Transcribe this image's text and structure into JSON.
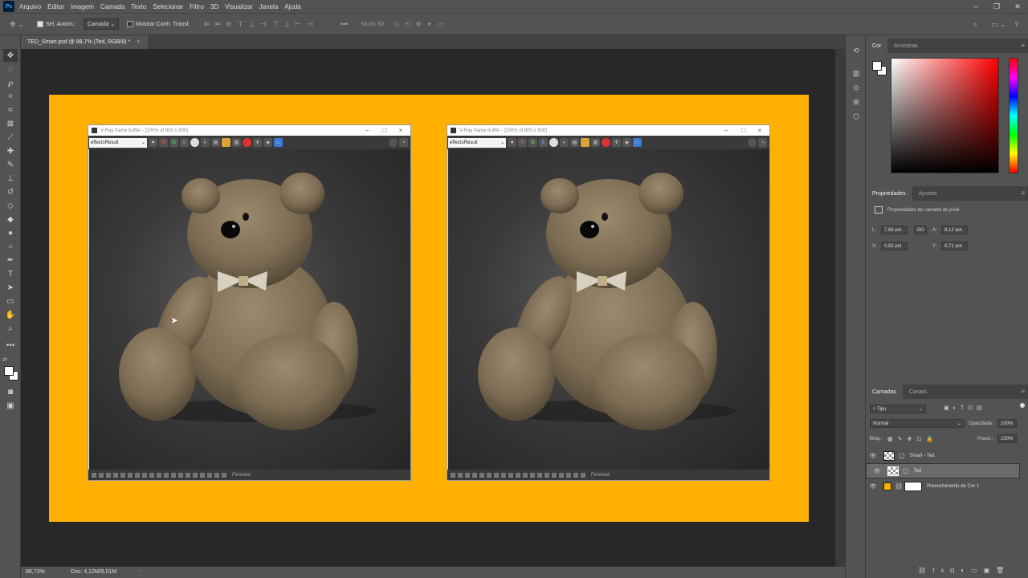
{
  "app": {
    "logo": "Ps"
  },
  "menu": [
    "Arquivo",
    "Editar",
    "Imagem",
    "Camada",
    "Texto",
    "Selecionar",
    "Filtro",
    "3D",
    "Visualizar",
    "Janela",
    "Ajuda"
  ],
  "options": {
    "auto_select_label": "Sel. Autom.:",
    "auto_select_value": "Camada",
    "show_transform_label": "Mostrar Contr. Transf.",
    "mode3d_label": "Modo 3D:"
  },
  "document": {
    "tab_title": "TED_Smart.psd @ 88,7% (Ted, RGB/8) *"
  },
  "vray_left": {
    "title": "V-Ray frame buffer - [100% of 800 x 800]",
    "channel": "effectsResult",
    "status": "Finished"
  },
  "vray_right": {
    "title": "V-Ray frame buffer - [100% of 800 x 800]",
    "channel": "effectsResult",
    "status": "Finished"
  },
  "statusbar": {
    "zoom": "88,73%",
    "doc": "Doc: 4,12M/9,01M"
  },
  "color_panel": {
    "tabs": [
      "Cor",
      "Amostras"
    ]
  },
  "properties_panel": {
    "tabs": [
      "Propriedades",
      "Ajustes"
    ],
    "heading": "Propriedades de camada de pixel",
    "w_label": "L:",
    "w_value": "7,66 pol.",
    "link_label": "GO",
    "h_label": "A:",
    "h_value": "8,12 pol.",
    "x_label": "X:",
    "x_value": "0,92 pol.",
    "y_label": "Y:",
    "y_value": "0,71 pol."
  },
  "layers_panel": {
    "tabs": [
      "Camadas",
      "Canais"
    ],
    "filter": "Tipo",
    "blend": "Normal",
    "opacity_label": "Opacidade:",
    "opacity_value": "100%",
    "lock_label": "Bloq.:",
    "fill_label": "Preen.:",
    "fill_value": "100%",
    "layers": [
      {
        "name": "Smart - Ted"
      },
      {
        "name": "Ted"
      },
      {
        "name": "Preenchimento de Cor 1"
      }
    ]
  },
  "colors": {
    "artboard": "#ffb000",
    "foreground": "#ffffff"
  }
}
